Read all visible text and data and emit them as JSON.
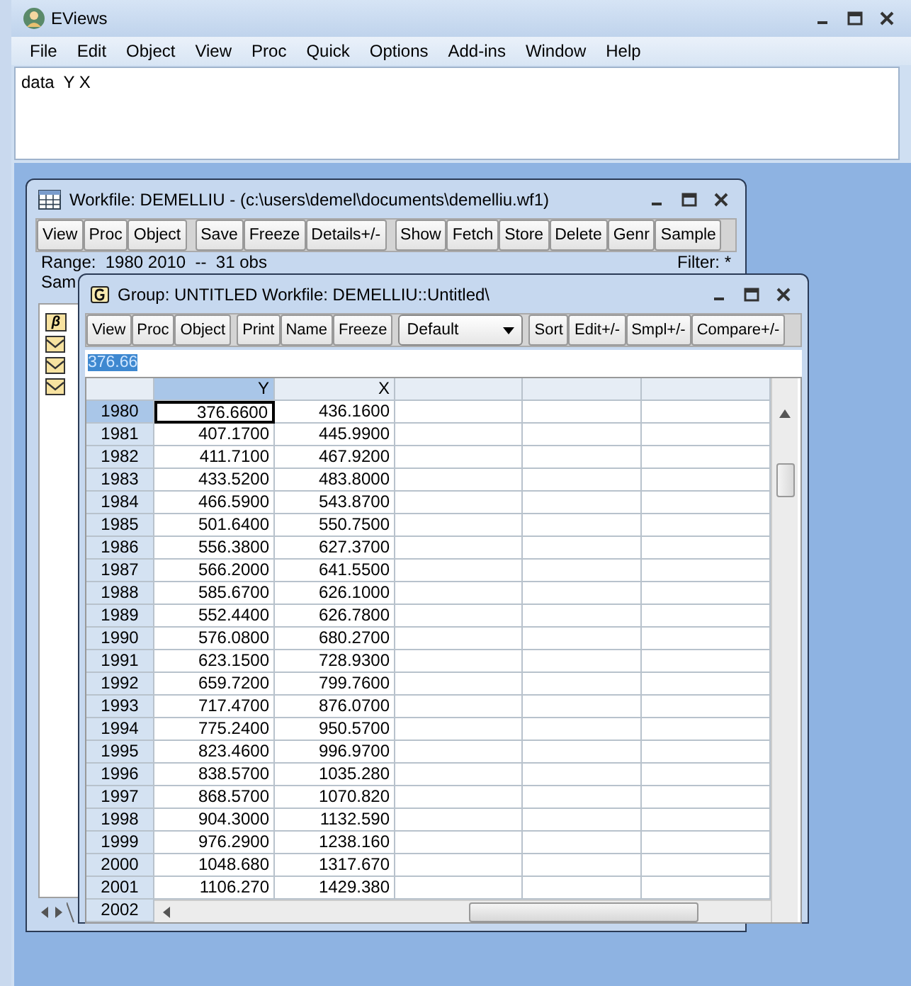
{
  "window": {
    "title": "EViews"
  },
  "menu": [
    "File",
    "Edit",
    "Object",
    "View",
    "Proc",
    "Quick",
    "Options",
    "Add-ins",
    "Window",
    "Help"
  ],
  "command": {
    "value": "data  Y X"
  },
  "workfile": {
    "title": "Workfile: DEMELLIU - (c:\\users\\demel\\documents\\demelliu.wf1)",
    "toolbar": [
      [
        "View",
        "Proc",
        "Object"
      ],
      [
        "Save",
        "Freeze",
        "Details+/-"
      ],
      [
        "Show",
        "Fetch",
        "Store",
        "Delete",
        "Genr",
        "Sample"
      ]
    ],
    "range": "Range:  1980 2010  --  31 obs",
    "filter": "Filter: *",
    "sample": "Sam",
    "objects": [
      {
        "kind": "coef",
        "glyph": "β"
      },
      {
        "kind": "series"
      },
      {
        "kind": "series"
      },
      {
        "kind": "series"
      }
    ]
  },
  "group": {
    "title": "Group: UNTITLED   Workfile: DEMELLIU::Untitled\\",
    "toolbar_left": [
      [
        "View",
        "Proc",
        "Object"
      ],
      [
        "Print",
        "Name",
        "Freeze"
      ]
    ],
    "dropdown": {
      "value": "Default"
    },
    "toolbar_right": [
      "Sort",
      "Edit+/-",
      "Smpl+/-",
      "Compare+/-"
    ],
    "edit_value": "376.66",
    "columns": [
      {
        "label": "Y",
        "selected": true
      },
      {
        "label": "X",
        "selected": false
      }
    ],
    "rows": [
      {
        "obs": "1980",
        "values": [
          "376.6600",
          "436.1600"
        ],
        "selected": true
      },
      {
        "obs": "1981",
        "values": [
          "407.1700",
          "445.9900"
        ],
        "selected": false
      },
      {
        "obs": "1982",
        "values": [
          "411.7100",
          "467.9200"
        ],
        "selected": false
      },
      {
        "obs": "1983",
        "values": [
          "433.5200",
          "483.8000"
        ],
        "selected": false
      },
      {
        "obs": "1984",
        "values": [
          "466.5900",
          "543.8700"
        ],
        "selected": false
      },
      {
        "obs": "1985",
        "values": [
          "501.6400",
          "550.7500"
        ],
        "selected": false
      },
      {
        "obs": "1986",
        "values": [
          "556.3800",
          "627.3700"
        ],
        "selected": false
      },
      {
        "obs": "1987",
        "values": [
          "566.2000",
          "641.5500"
        ],
        "selected": false
      },
      {
        "obs": "1988",
        "values": [
          "585.6700",
          "626.1000"
        ],
        "selected": false
      },
      {
        "obs": "1989",
        "values": [
          "552.4400",
          "626.7800"
        ],
        "selected": false
      },
      {
        "obs": "1990",
        "values": [
          "576.0800",
          "680.2700"
        ],
        "selected": false
      },
      {
        "obs": "1991",
        "values": [
          "623.1500",
          "728.9300"
        ],
        "selected": false
      },
      {
        "obs": "1992",
        "values": [
          "659.7200",
          "799.7600"
        ],
        "selected": false
      },
      {
        "obs": "1993",
        "values": [
          "717.4700",
          "876.0700"
        ],
        "selected": false
      },
      {
        "obs": "1994",
        "values": [
          "775.2400",
          "950.5700"
        ],
        "selected": false
      },
      {
        "obs": "1995",
        "values": [
          "823.4600",
          "996.9700"
        ],
        "selected": false
      },
      {
        "obs": "1996",
        "values": [
          "838.5700",
          "1035.280"
        ],
        "selected": false
      },
      {
        "obs": "1997",
        "values": [
          "868.5700",
          "1070.820"
        ],
        "selected": false
      },
      {
        "obs": "1998",
        "values": [
          "904.3000",
          "1132.590"
        ],
        "selected": false
      },
      {
        "obs": "1999",
        "values": [
          "976.2900",
          "1238.160"
        ],
        "selected": false
      },
      {
        "obs": "2000",
        "values": [
          "1048.680",
          "1317.670"
        ],
        "selected": false
      },
      {
        "obs": "2001",
        "values": [
          "1106.270",
          "1429.380"
        ],
        "selected": false
      }
    ],
    "last_row": {
      "obs": "2002"
    }
  }
}
